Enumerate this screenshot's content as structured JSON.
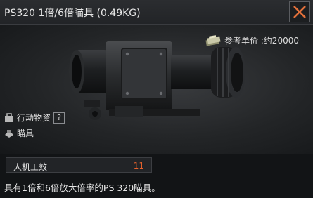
{
  "header": {
    "title": "PS320 1倍/6倍瞄具 (0.49KG)"
  },
  "price": {
    "label": "参考单价 :约20000"
  },
  "tags": {
    "category": "行动物资",
    "help": "?",
    "type": "瞄具"
  },
  "stats": {
    "ergonomics_label": "人机工效",
    "ergonomics_value": "-11"
  },
  "description": "具有1倍和6倍放大倍率的PS 320瞄具。",
  "colors": {
    "accent": "#e8622c",
    "close_x": "#e2703a"
  }
}
